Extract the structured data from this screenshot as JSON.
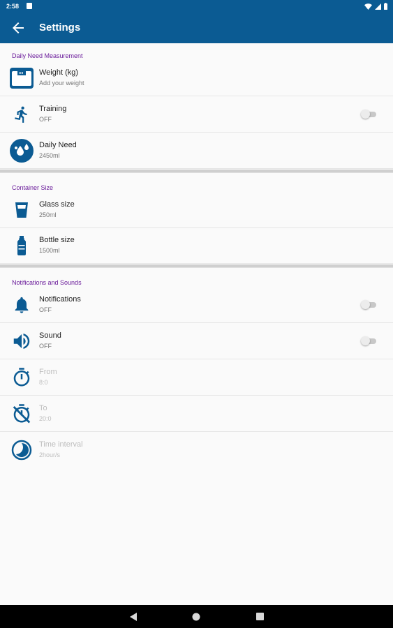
{
  "status_bar": {
    "time": "2:58"
  },
  "app_bar": {
    "title": "Settings"
  },
  "sections": [
    {
      "title": "Daily Need Measurement",
      "items": [
        {
          "icon": "weight-scale-icon",
          "title": "Weight (kg)",
          "summary": "Add your weight"
        },
        {
          "icon": "running-icon",
          "title": "Training",
          "summary": "OFF",
          "switch": false
        },
        {
          "icon": "water-drop-icon",
          "title": "Daily Need",
          "summary": "2450ml"
        }
      ]
    },
    {
      "title": "Container Size",
      "items": [
        {
          "icon": "glass-icon",
          "title": "Glass size",
          "summary": "250ml"
        },
        {
          "icon": "bottle-icon",
          "title": "Bottle size",
          "summary": "1500ml"
        }
      ]
    },
    {
      "title": "Notifications and Sounds",
      "items": [
        {
          "icon": "bell-icon",
          "title": "Notifications",
          "summary": "OFF",
          "switch": false
        },
        {
          "icon": "speaker-icon",
          "title": "Sound",
          "summary": "OFF",
          "switch": false
        },
        {
          "icon": "timer-icon",
          "title": "From",
          "summary": "8:0",
          "disabled": true
        },
        {
          "icon": "timer-off-icon",
          "title": "To",
          "summary": "20:0",
          "disabled": true
        },
        {
          "icon": "clock-interval-icon",
          "title": "Time interval",
          "summary": "2hour/s",
          "disabled": true
        }
      ]
    }
  ],
  "colors": {
    "primary": "#0b5b93",
    "category": "#6a1b9a",
    "icon": "#0b5b93",
    "icon_disabled": "#0b5b93"
  }
}
